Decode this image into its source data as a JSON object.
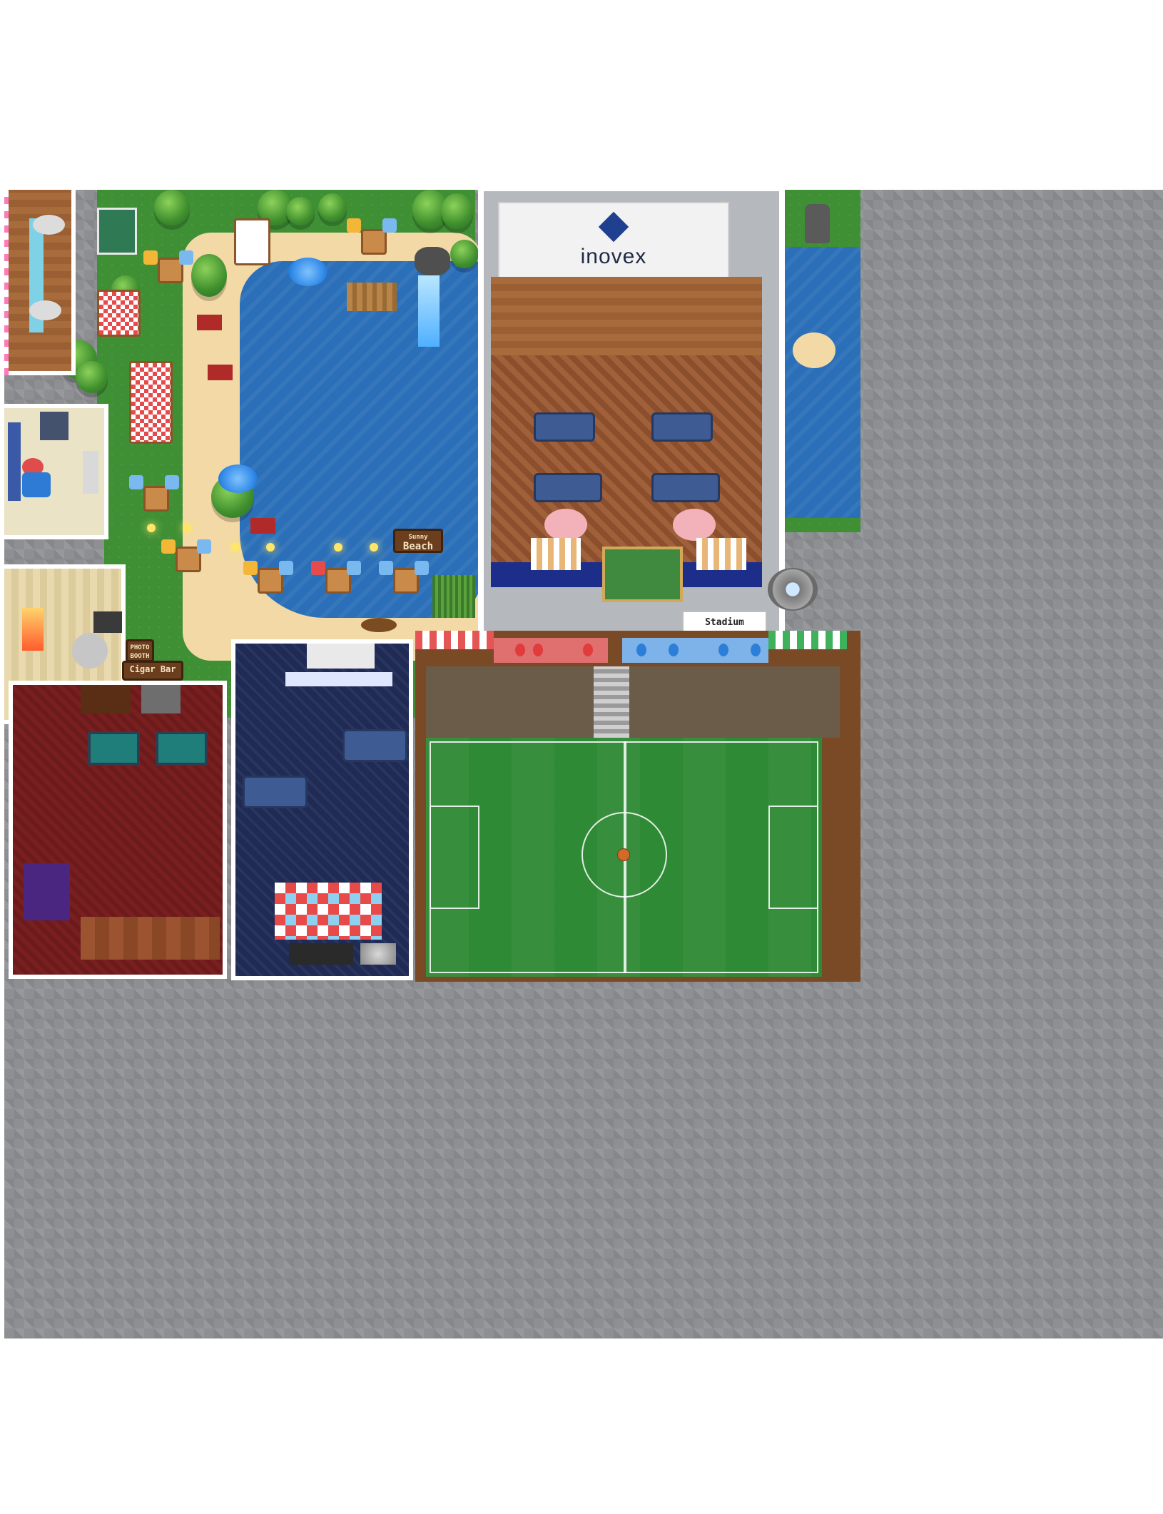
{
  "map": {
    "company_banner": "inovex",
    "sunny_beach_sign": {
      "line1": "Sunny",
      "line2": "Beach"
    },
    "photo_booth_sign": {
      "line1": "PHOTO",
      "line2": "BOOTH"
    },
    "cigar_bar_sign": "Cigar Bar",
    "stadium_sign": "Stadium"
  },
  "colors": {
    "grass": "#3f8f35",
    "water": "#2a6fb8",
    "sand": "#f2d9a6",
    "cobblestone": "#8d8f93",
    "cigar_bar_floor": "#7a1f1f",
    "lounge_floor": "#1f2a55",
    "pitch": "#2f8a35"
  },
  "icons": [
    "tree-icon",
    "umbrella-icon",
    "fountain-icon",
    "soccer-ball-icon",
    "balloon-icon",
    "piano-icon",
    "pool-table-icon",
    "drum-kit-icon"
  ]
}
